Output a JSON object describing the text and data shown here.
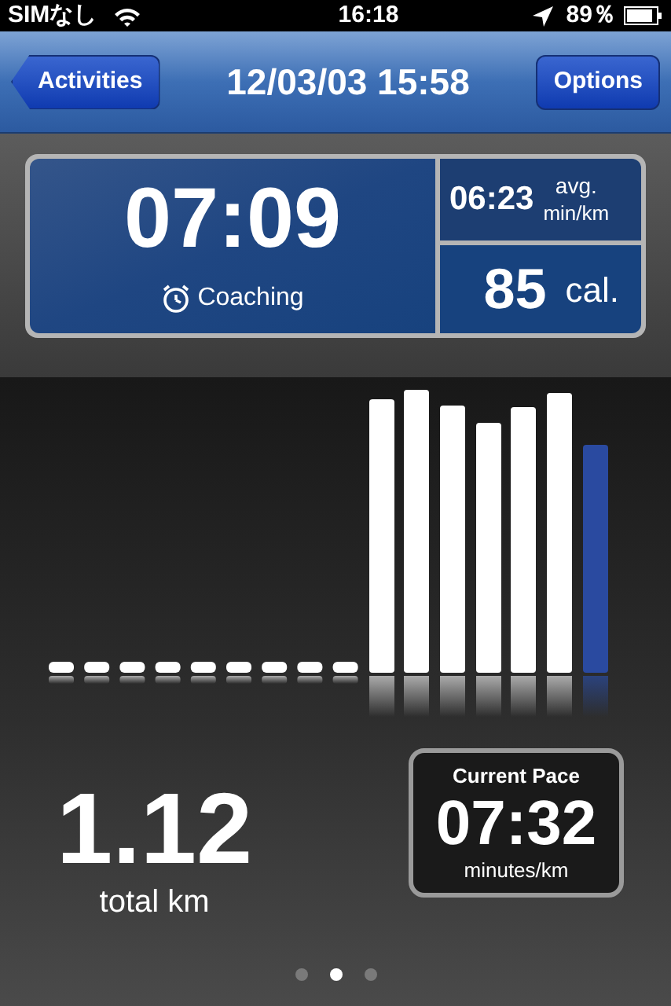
{
  "status_bar": {
    "carrier": "SIMなし",
    "time": "16:18",
    "battery": "89％"
  },
  "nav_bar": {
    "back_button": "Activities",
    "title": "12/03/03 15:58",
    "right_button": "Options"
  },
  "summary": {
    "duration": "07:09",
    "mode": "Coaching",
    "avg_pace": "06:23",
    "avg_label": "avg.",
    "avg_unit": "min/km",
    "calories": "85",
    "calories_unit": "cal."
  },
  "distance": {
    "value": "1.12",
    "unit": "total km"
  },
  "current_pace": {
    "title": "Current Pace",
    "value": "07:32",
    "unit": "minutes/km"
  },
  "pages": [
    {
      "selected": false
    },
    {
      "selected": true
    },
    {
      "selected": false
    }
  ]
}
